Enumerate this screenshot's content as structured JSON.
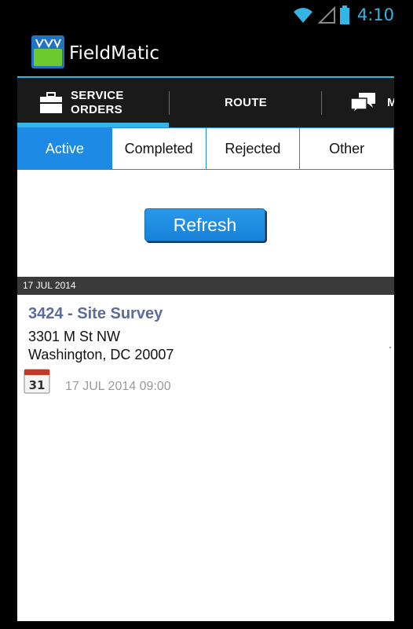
{
  "status_bar": {
    "time": "4:10",
    "icons": [
      "wifi-icon",
      "signal-icon",
      "battery-icon"
    ]
  },
  "action_bar": {
    "title": "FieldMatic",
    "logo_text": "Field"
  },
  "tabs": [
    {
      "line1": "SERVICE",
      "line2": "ORDERS",
      "icon": "briefcase-icon",
      "selected": true
    },
    {
      "label": "ROUTE",
      "selected": false
    },
    {
      "label": "M",
      "icon": "chat-bubbles-icon",
      "selected": false
    }
  ],
  "filters": [
    {
      "label": "Active",
      "selected": true
    },
    {
      "label": "Completed",
      "selected": false
    },
    {
      "label": "Rejected",
      "selected": false
    },
    {
      "label": "Other",
      "selected": false
    }
  ],
  "refresh_label": "Refresh",
  "section_header": "17 JUL 2014",
  "order": {
    "title": "3424 - Site Survey",
    "address_line1": "3301 M St NW",
    "address_line2": "Washington, DC 20007",
    "scheduled": "17 JUL 2014 09:00",
    "calendar_day": "31"
  },
  "colors": {
    "accent": "#33b5e5",
    "primary_blue": "#1d8be6",
    "title_blue": "#5b6b9a"
  }
}
